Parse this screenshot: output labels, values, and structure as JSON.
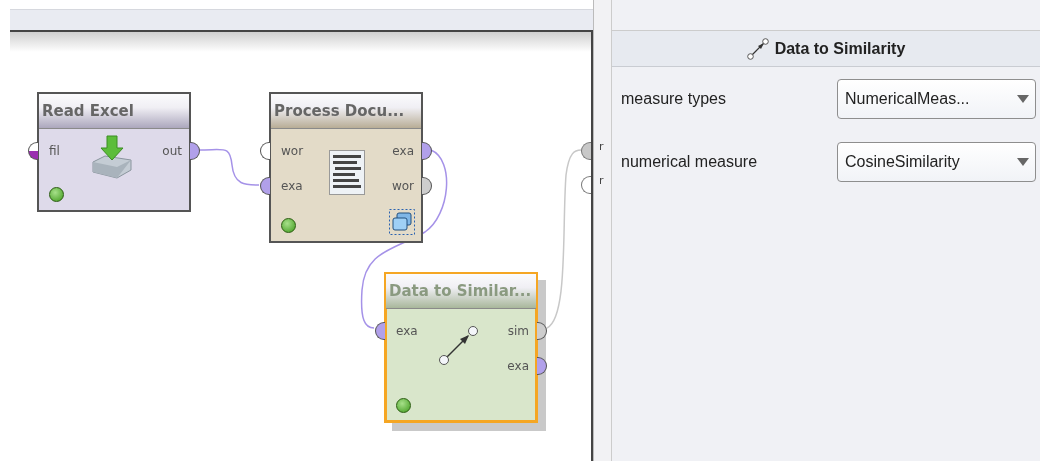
{
  "canvas": {
    "result_ports": [
      {
        "label": "r",
        "connected": true
      },
      {
        "label": "r",
        "connected": false
      }
    ]
  },
  "operators": [
    {
      "name": "Read Excel",
      "kind": "import",
      "color": "#dedaea",
      "selected": false,
      "valid": true,
      "inputs": [
        {
          "label": "fil",
          "kind": "file"
        }
      ],
      "outputs": [
        {
          "label": "out",
          "kind": "example"
        }
      ]
    },
    {
      "name": "Process Docu...",
      "kind": "subprocess",
      "color": "#e3dbc8",
      "selected": false,
      "valid": true,
      "inputs": [
        {
          "label": "wor",
          "kind": "other"
        },
        {
          "label": "exa",
          "kind": "example"
        }
      ],
      "outputs": [
        {
          "label": "exa",
          "kind": "example"
        },
        {
          "label": "wor",
          "kind": "other"
        }
      ]
    },
    {
      "name": "Data to Similar...",
      "kind": "similarity",
      "color": "#d9e6cb",
      "selected": true,
      "valid": true,
      "inputs": [
        {
          "label": "exa",
          "kind": "example"
        }
      ],
      "outputs": [
        {
          "label": "sim",
          "kind": "other"
        },
        {
          "label": "exa",
          "kind": "example"
        }
      ]
    }
  ],
  "parameters_panel": {
    "title": "Data to Similarity",
    "parameters": [
      {
        "label": "measure types",
        "value": "NumericalMeas..."
      },
      {
        "label": "numerical measure",
        "value": "CosineSimilarity"
      }
    ]
  }
}
